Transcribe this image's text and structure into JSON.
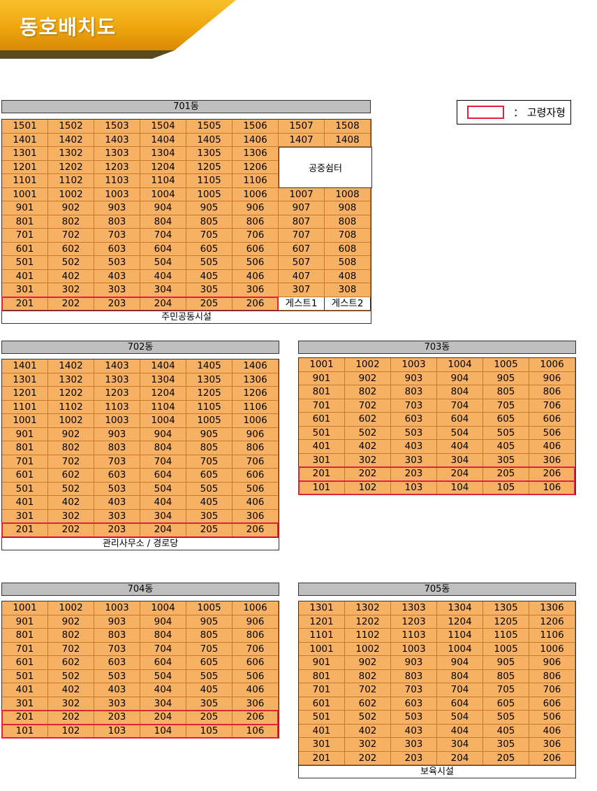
{
  "title": "동호배치도",
  "legend": {
    "label": "： 고령자형"
  },
  "buildings": [
    {
      "name": "701동",
      "rows": [
        [
          "1501",
          "1502",
          "1503",
          "1504",
          "1505",
          "1506",
          "1507",
          "1508"
        ],
        [
          "1401",
          "1402",
          "1403",
          "1404",
          "1405",
          "1406",
          "1407",
          "1408"
        ],
        [
          "1301",
          "1302",
          "1303",
          "1304",
          "1305",
          "1306",
          "",
          ""
        ],
        [
          "1201",
          "1202",
          "1203",
          "1204",
          "1205",
          "1206",
          "",
          ""
        ],
        [
          "1101",
          "1102",
          "1103",
          "1104",
          "1105",
          "1106",
          "",
          ""
        ],
        [
          "1001",
          "1002",
          "1003",
          "1004",
          "1005",
          "1006",
          "1007",
          "1008"
        ],
        [
          "901",
          "902",
          "903",
          "904",
          "905",
          "906",
          "907",
          "908"
        ],
        [
          "801",
          "802",
          "803",
          "804",
          "805",
          "806",
          "807",
          "808"
        ],
        [
          "701",
          "702",
          "703",
          "704",
          "705",
          "706",
          "707",
          "708"
        ],
        [
          "601",
          "602",
          "603",
          "604",
          "605",
          "606",
          "607",
          "608"
        ],
        [
          "501",
          "502",
          "503",
          "504",
          "505",
          "506",
          "507",
          "508"
        ],
        [
          "401",
          "402",
          "403",
          "404",
          "405",
          "406",
          "407",
          "408"
        ],
        [
          "301",
          "302",
          "303",
          "304",
          "305",
          "306",
          "307",
          "308"
        ],
        [
          "201",
          "202",
          "203",
          "204",
          "205",
          "206",
          "게스트1",
          "게스트2"
        ]
      ],
      "shelter": "공중쉼터",
      "footer": "주민공동시설"
    },
    {
      "name": "702동",
      "rows": [
        [
          "1401",
          "1402",
          "1403",
          "1404",
          "1405",
          "1406"
        ],
        [
          "1301",
          "1302",
          "1303",
          "1304",
          "1305",
          "1306"
        ],
        [
          "1201",
          "1202",
          "1203",
          "1204",
          "1205",
          "1206"
        ],
        [
          "1101",
          "1102",
          "1103",
          "1104",
          "1105",
          "1106"
        ],
        [
          "1001",
          "1002",
          "1003",
          "1004",
          "1005",
          "1006"
        ],
        [
          "901",
          "902",
          "903",
          "904",
          "905",
          "906"
        ],
        [
          "801",
          "802",
          "803",
          "804",
          "805",
          "806"
        ],
        [
          "701",
          "702",
          "703",
          "704",
          "705",
          "706"
        ],
        [
          "601",
          "602",
          "603",
          "604",
          "605",
          "606"
        ],
        [
          "501",
          "502",
          "503",
          "504",
          "505",
          "506"
        ],
        [
          "401",
          "402",
          "403",
          "404",
          "405",
          "406"
        ],
        [
          "301",
          "302",
          "303",
          "304",
          "305",
          "306"
        ],
        [
          "201",
          "202",
          "203",
          "204",
          "205",
          "206"
        ]
      ],
      "footer": "관리사무소 / 경로당"
    },
    {
      "name": "703동",
      "rows": [
        [
          "1001",
          "1002",
          "1003",
          "1004",
          "1005",
          "1006"
        ],
        [
          "901",
          "902",
          "903",
          "904",
          "905",
          "906"
        ],
        [
          "801",
          "802",
          "803",
          "804",
          "805",
          "806"
        ],
        [
          "701",
          "702",
          "703",
          "704",
          "705",
          "706"
        ],
        [
          "601",
          "602",
          "603",
          "604",
          "605",
          "606"
        ],
        [
          "501",
          "502",
          "503",
          "504",
          "505",
          "506"
        ],
        [
          "401",
          "402",
          "403",
          "404",
          "405",
          "406"
        ],
        [
          "301",
          "302",
          "303",
          "304",
          "305",
          "306"
        ],
        [
          "201",
          "202",
          "203",
          "204",
          "205",
          "206"
        ],
        [
          "101",
          "102",
          "103",
          "104",
          "105",
          "106"
        ]
      ]
    },
    {
      "name": "704동",
      "rows": [
        [
          "1001",
          "1002",
          "1003",
          "1004",
          "1005",
          "1006"
        ],
        [
          "901",
          "902",
          "903",
          "904",
          "905",
          "906"
        ],
        [
          "801",
          "802",
          "803",
          "804",
          "805",
          "806"
        ],
        [
          "701",
          "702",
          "703",
          "704",
          "705",
          "706"
        ],
        [
          "601",
          "602",
          "603",
          "604",
          "605",
          "606"
        ],
        [
          "501",
          "502",
          "503",
          "504",
          "505",
          "506"
        ],
        [
          "401",
          "402",
          "403",
          "404",
          "405",
          "406"
        ],
        [
          "301",
          "302",
          "303",
          "304",
          "305",
          "306"
        ],
        [
          "201",
          "202",
          "203",
          "204",
          "205",
          "206"
        ],
        [
          "101",
          "102",
          "103",
          "104",
          "105",
          "106"
        ]
      ]
    },
    {
      "name": "705동",
      "rows": [
        [
          "1301",
          "1302",
          "1303",
          "1304",
          "1305",
          "1306"
        ],
        [
          "1201",
          "1202",
          "1203",
          "1204",
          "1205",
          "1206"
        ],
        [
          "1101",
          "1102",
          "1103",
          "1104",
          "1105",
          "1106"
        ],
        [
          "1001",
          "1002",
          "1003",
          "1004",
          "1005",
          "1006"
        ],
        [
          "901",
          "902",
          "903",
          "904",
          "905",
          "906"
        ],
        [
          "801",
          "802",
          "803",
          "804",
          "805",
          "806"
        ],
        [
          "701",
          "702",
          "703",
          "704",
          "705",
          "706"
        ],
        [
          "601",
          "602",
          "603",
          "604",
          "605",
          "606"
        ],
        [
          "501",
          "502",
          "503",
          "504",
          "505",
          "506"
        ],
        [
          "401",
          "402",
          "403",
          "404",
          "405",
          "406"
        ],
        [
          "301",
          "302",
          "303",
          "304",
          "305",
          "306"
        ],
        [
          "201",
          "202",
          "203",
          "204",
          "205",
          "206"
        ]
      ],
      "footer": "보육시설"
    }
  ]
}
